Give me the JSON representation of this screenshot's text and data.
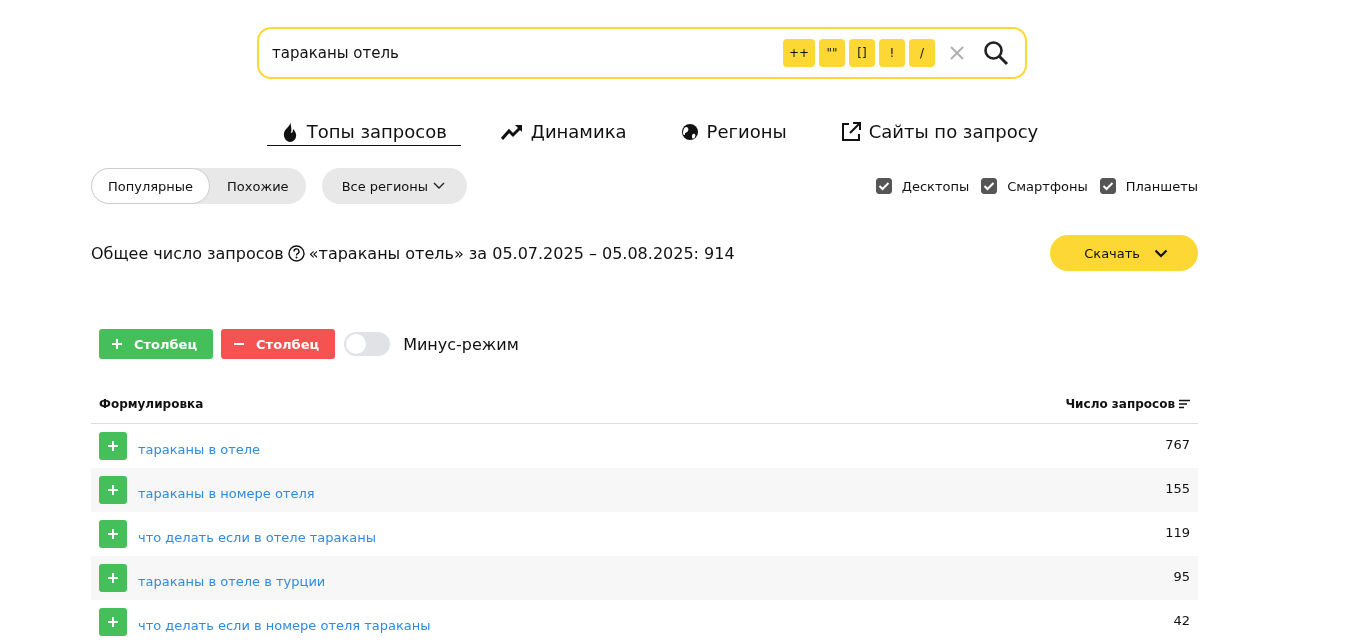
{
  "search": {
    "value": "тараканы отель",
    "operators": [
      "++",
      "\"\"",
      "[]",
      "!",
      "/"
    ]
  },
  "tabs": [
    {
      "label": "Топы запросов",
      "selected": true
    },
    {
      "label": "Динамика",
      "selected": false
    },
    {
      "label": "Регионы",
      "selected": false
    },
    {
      "label": "Сайты по запросу",
      "selected": false
    }
  ],
  "mode_switch": [
    {
      "label": "Популярные",
      "selected": true
    },
    {
      "label": "Похожие",
      "selected": false
    }
  ],
  "region_select": {
    "label": "Все регионы"
  },
  "devices": [
    {
      "label": "Десктопы",
      "checked": true
    },
    {
      "label": "Смартфоны",
      "checked": true
    },
    {
      "label": "Планшеты",
      "checked": true
    }
  ],
  "summary": {
    "label": "Общее число запросов",
    "detail": "«тараканы отель» за 05.07.2025 – 05.08.2025: 914"
  },
  "download_button": {
    "label": "Скачать"
  },
  "column_buttons": [
    {
      "kind": "add",
      "label": "Столбец"
    },
    {
      "kind": "remove",
      "label": "Столбец"
    }
  ],
  "minus_mode": {
    "label": "Минус-режим",
    "on": false
  },
  "table": {
    "columns": [
      "Формулировка",
      "Число запросов"
    ],
    "rows": [
      {
        "phrase": "тараканы в отеле",
        "count": "767"
      },
      {
        "phrase": "тараканы в номере отеля",
        "count": "155"
      },
      {
        "phrase": "что делать если в отеле тараканы",
        "count": "119"
      },
      {
        "phrase": "тараканы в отеле в турции",
        "count": "95"
      },
      {
        "phrase": "что делать если в номере отеля тараканы",
        "count": "42"
      }
    ]
  }
}
